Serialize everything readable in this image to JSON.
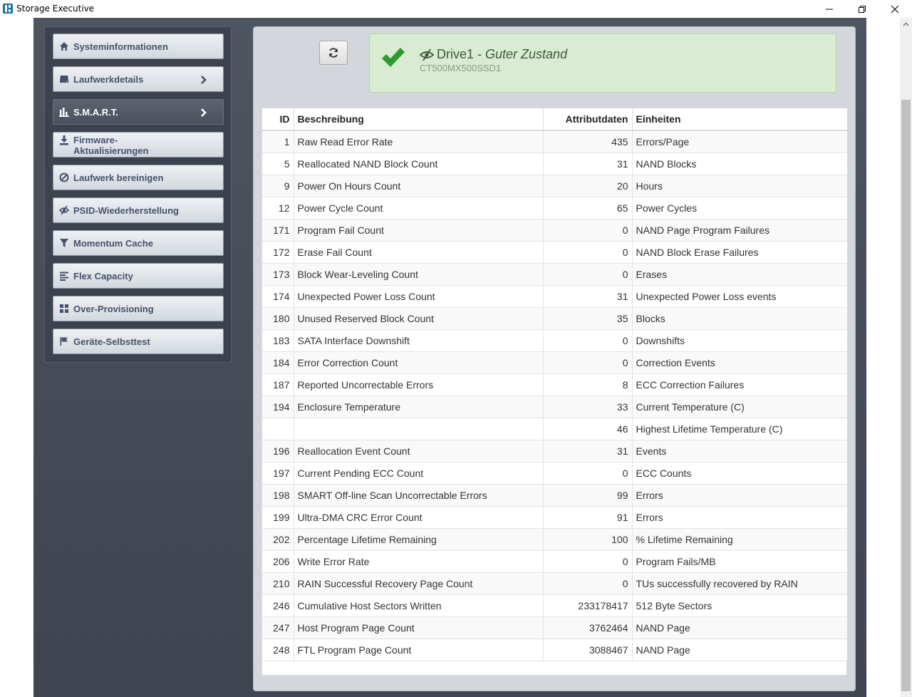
{
  "window": {
    "title": "Storage Executive"
  },
  "colors": {
    "status_ok": "#2e9a2e",
    "sidebar_bg": "#3c434e",
    "nav_text": "#44526a"
  },
  "sidebar": {
    "items": [
      {
        "label": "Systeminformationen",
        "icon": "home-icon",
        "chevron": false,
        "active": false
      },
      {
        "label": "Laufwerkdetails",
        "icon": "drive-icon",
        "chevron": true,
        "active": false
      },
      {
        "label": "S.M.A.R.T.",
        "icon": "bar-chart-icon",
        "chevron": true,
        "active": true
      },
      {
        "label": "Firmware-\nAktualisierungen",
        "icon": "download-icon",
        "chevron": false,
        "active": false
      },
      {
        "label": "Laufwerk bereinigen",
        "icon": "ban-icon",
        "chevron": false,
        "active": false
      },
      {
        "label": "PSID-Wiederherstellung",
        "icon": "eye-slash-icon",
        "chevron": false,
        "active": false
      },
      {
        "label": "Momentum Cache",
        "icon": "filter-icon",
        "chevron": false,
        "active": false
      },
      {
        "label": "Flex Capacity",
        "icon": "align-left-icon",
        "chevron": false,
        "active": false
      },
      {
        "label": "Over-Provisioning",
        "icon": "grid-icon",
        "chevron": false,
        "active": false
      },
      {
        "label": "Geräte-Selbsttest",
        "icon": "flag-icon",
        "chevron": false,
        "active": false
      }
    ]
  },
  "status": {
    "drive_name": "Drive1",
    "separator": "-",
    "state": "Guter Zustand",
    "model": "CT500MX500SSD1"
  },
  "table": {
    "headers": {
      "id": "ID",
      "description": "Beschreibung",
      "value": "Attributdaten",
      "unit": "Einheiten"
    },
    "rows": [
      {
        "id": "1",
        "description": "Raw Read Error Rate",
        "value": "435",
        "unit": "Errors/Page"
      },
      {
        "id": "5",
        "description": "Reallocated NAND Block Count",
        "value": "31",
        "unit": "NAND Blocks"
      },
      {
        "id": "9",
        "description": "Power On Hours Count",
        "value": "20",
        "unit": "Hours"
      },
      {
        "id": "12",
        "description": "Power Cycle Count",
        "value": "65",
        "unit": "Power Cycles"
      },
      {
        "id": "171",
        "description": "Program Fail Count",
        "value": "0",
        "unit": "NAND Page Program Failures"
      },
      {
        "id": "172",
        "description": "Erase Fail Count",
        "value": "0",
        "unit": "NAND Block Erase Failures"
      },
      {
        "id": "173",
        "description": "Block Wear-Leveling Count",
        "value": "0",
        "unit": "Erases"
      },
      {
        "id": "174",
        "description": "Unexpected Power Loss Count",
        "value": "31",
        "unit": "Unexpected Power Loss events"
      },
      {
        "id": "180",
        "description": "Unused Reserved Block Count",
        "value": "35",
        "unit": "Blocks"
      },
      {
        "id": "183",
        "description": "SATA Interface Downshift",
        "value": "0",
        "unit": "Downshifts"
      },
      {
        "id": "184",
        "description": "Error Correction Count",
        "value": "0",
        "unit": "Correction Events"
      },
      {
        "id": "187",
        "description": "Reported Uncorrectable Errors",
        "value": "8",
        "unit": "ECC Correction Failures"
      },
      {
        "id": "194",
        "description": "Enclosure Temperature",
        "value": "33",
        "unit": "Current Temperature (C)"
      },
      {
        "id": "",
        "description": "",
        "value": "46",
        "unit": "Highest Lifetime Temperature (C)"
      },
      {
        "id": "196",
        "description": "Reallocation Event Count",
        "value": "31",
        "unit": "Events"
      },
      {
        "id": "197",
        "description": "Current Pending ECC Count",
        "value": "0",
        "unit": "ECC Counts"
      },
      {
        "id": "198",
        "description": "SMART Off-line Scan Uncorrectable Errors",
        "value": "99",
        "unit": "Errors"
      },
      {
        "id": "199",
        "description": "Ultra-DMA CRC Error Count",
        "value": "91",
        "unit": "Errors"
      },
      {
        "id": "202",
        "description": "Percentage Lifetime Remaining",
        "value": "100",
        "unit": "% Lifetime Remaining"
      },
      {
        "id": "206",
        "description": "Write Error Rate",
        "value": "0",
        "unit": "Program Fails/MB"
      },
      {
        "id": "210",
        "description": "RAIN Successful Recovery Page Count",
        "value": "0",
        "unit": "TUs successfully recovered by RAIN"
      },
      {
        "id": "246",
        "description": "Cumulative Host Sectors Written",
        "value": "233178417",
        "unit": "512 Byte Sectors"
      },
      {
        "id": "247",
        "description": "Host Program Page Count",
        "value": "3762464",
        "unit": "NAND Page"
      },
      {
        "id": "248",
        "description": "FTL Program Page Count",
        "value": "3088467",
        "unit": "NAND Page"
      }
    ]
  }
}
